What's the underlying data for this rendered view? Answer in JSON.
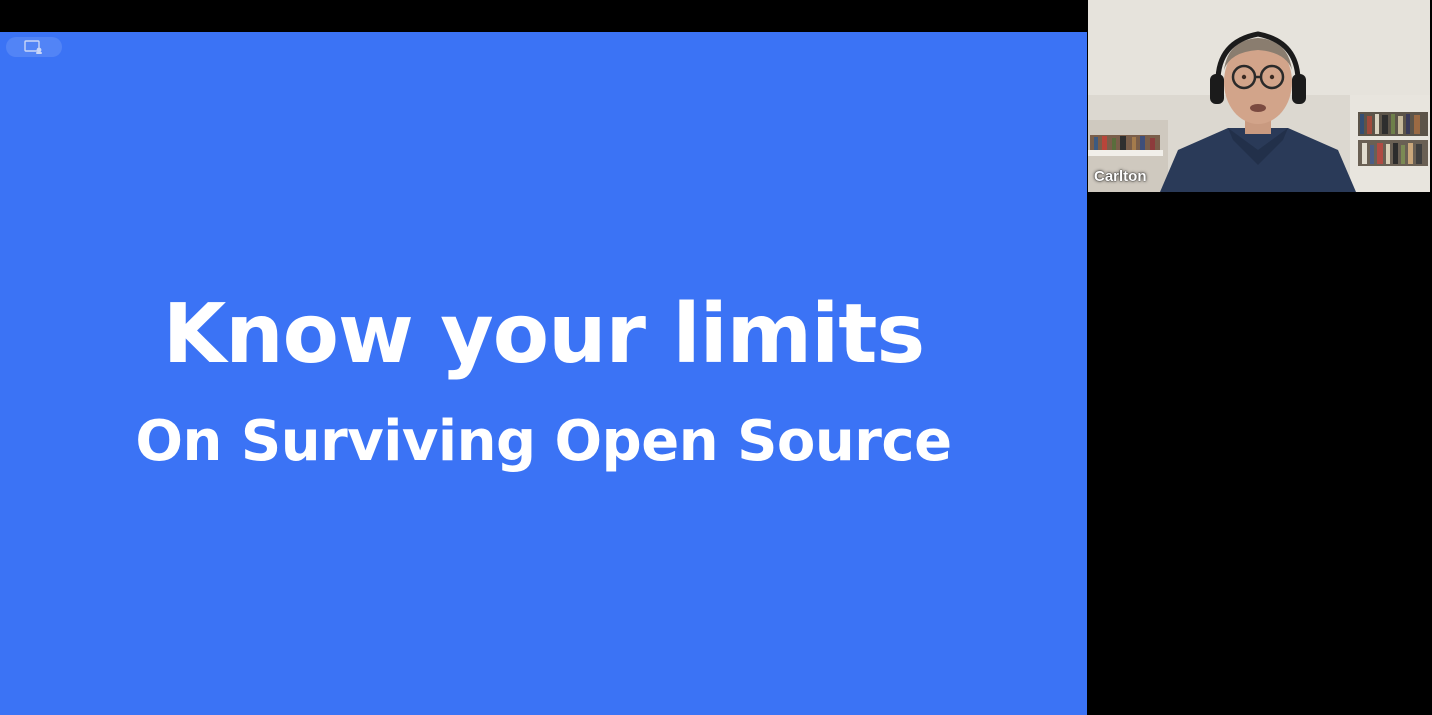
{
  "colors": {
    "background": "#000000",
    "slide_background": "#3b73f5",
    "slide_text": "#ffffff"
  },
  "toolbar": {
    "share_icon": "screen-share-icon"
  },
  "slide": {
    "title": "Know your limits",
    "subtitle": "On Surviving Open Source"
  },
  "participant": {
    "name": "Carlton"
  }
}
